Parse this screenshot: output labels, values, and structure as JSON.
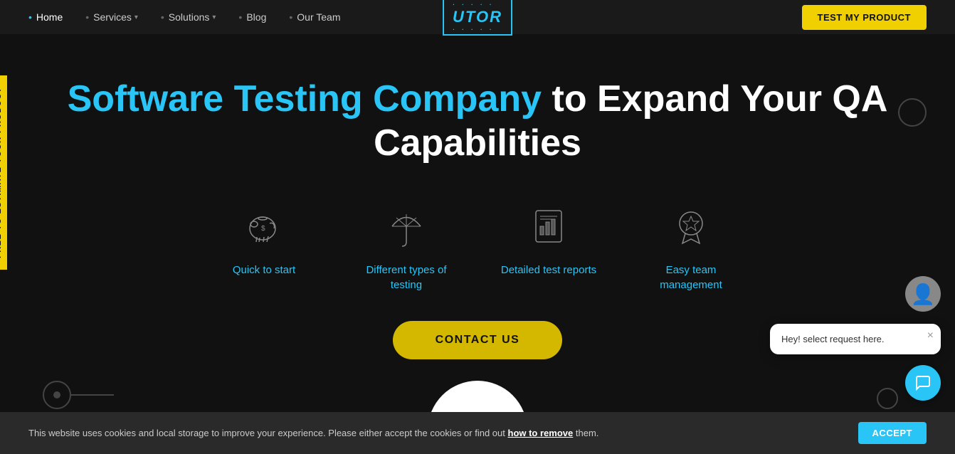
{
  "nav": {
    "home_label": "Home",
    "services_label": "Services",
    "solutions_label": "Solutions",
    "blog_label": "Blog",
    "our_team_label": "Our Team",
    "logo_text": "UTOR",
    "cta_label": "TEST MY PRODUCT"
  },
  "side_banner": {
    "label": "FREE TO ESTIMATE YOUR PRODUCT"
  },
  "hero": {
    "headline_color": "Software Testing Company",
    "headline_white": "to Expand Your QA Capabilities"
  },
  "features": [
    {
      "id": "quick-start",
      "label": "Quick to start",
      "icon": "piggy-bank"
    },
    {
      "id": "types-testing",
      "label": "Different types of testing",
      "icon": "umbrella"
    },
    {
      "id": "test-reports",
      "label": "Detailed test reports",
      "icon": "report"
    },
    {
      "id": "team-mgmt",
      "label": "Easy team management",
      "icon": "award"
    }
  ],
  "cta": {
    "label": "CONTACT US"
  },
  "cookie": {
    "text": "This website uses cookies and local storage to improve your experience. Please either accept the cookies or find out",
    "link_text": "how to remove",
    "text_end": "them.",
    "accept_label": "ACCEPT"
  },
  "chat": {
    "message": "Hey! select request here.",
    "close_label": "×"
  },
  "colors": {
    "accent_cyan": "#29c5f6",
    "accent_yellow": "#d4b800",
    "bg_dark": "#111",
    "nav_bg": "#1a1a1a"
  }
}
